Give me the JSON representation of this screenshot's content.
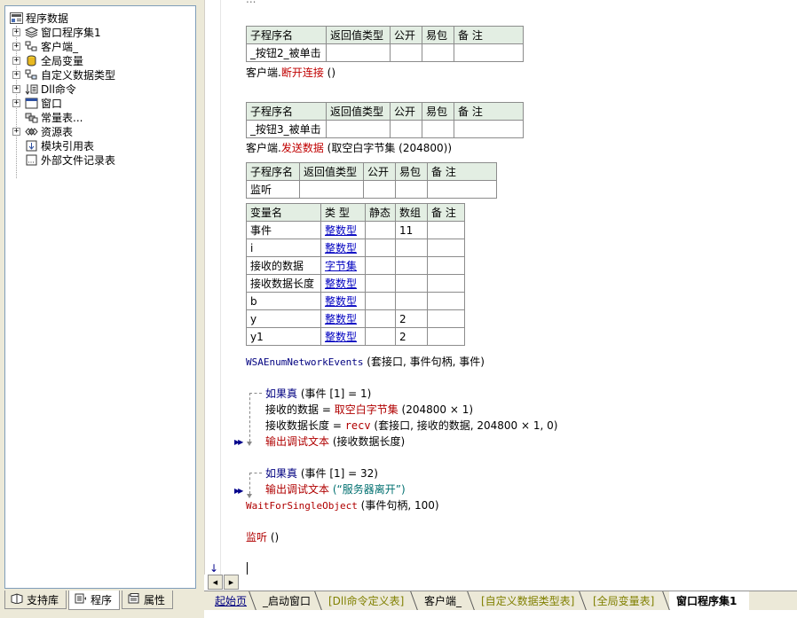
{
  "tree": {
    "root": {
      "icon": "program-data-icon",
      "label": "程序数据"
    },
    "items": [
      {
        "label": "窗口程序集1",
        "icon": "layers-icon",
        "expandable": true
      },
      {
        "label": "客户端_",
        "icon": "class-module-icon",
        "expandable": true
      },
      {
        "label": "全局变量",
        "icon": "database-icon",
        "expandable": true
      },
      {
        "label": "自定义数据类型",
        "icon": "data-type-icon",
        "expandable": true
      },
      {
        "label": "Dll命令",
        "icon": "dll-command-icon",
        "expandable": true
      },
      {
        "label": "窗口",
        "icon": "window-icon",
        "expandable": true
      },
      {
        "label": "常量表...",
        "icon": "constants-icon",
        "expandable": false
      },
      {
        "label": "资源表",
        "icon": "resources-icon",
        "expandable": true
      },
      {
        "label": "模块引用表",
        "icon": "module-ref-icon",
        "expandable": false
      },
      {
        "label": "外部文件记录表",
        "icon": "external-file-icon",
        "expandable": false
      }
    ]
  },
  "panel_tabs": [
    {
      "label": "支持库",
      "icon": "book-icon"
    },
    {
      "label": "程序",
      "icon": "program-icon",
      "active": true
    },
    {
      "label": "属性",
      "icon": "properties-icon"
    }
  ],
  "proc_header": {
    "name": "子程序名",
    "ret": "返回值类型",
    "public": "公开",
    "easy": "易包",
    "note": "备 注"
  },
  "var_header": {
    "name": "变量名",
    "type": "类 型",
    "static": "静态",
    "array": "数组",
    "note": "备 注"
  },
  "top_partial": "...",
  "procs": [
    {
      "name": "_按钮2_被单击",
      "code_obj": "客户端.",
      "code_method": "断开连接",
      "code_args": " ()"
    },
    {
      "name": "_按钮3_被单击",
      "code_obj": "客户端.",
      "code_method": "发送数据",
      "code_args": " (取空白字节集 (204800))"
    },
    {
      "name": "监听"
    }
  ],
  "variables": [
    {
      "name": "事件",
      "type": "整数型",
      "static": "",
      "array": "11",
      "note": ""
    },
    {
      "name": "i",
      "type": "整数型",
      "static": "",
      "array": "",
      "note": ""
    },
    {
      "name": "接收的数据",
      "type": "字节集",
      "static": "",
      "array": "",
      "note": ""
    },
    {
      "name": "接收数据长度",
      "type": "整数型",
      "static": "",
      "array": "",
      "note": ""
    },
    {
      "name": "b",
      "type": "整数型",
      "static": "",
      "array": "",
      "note": ""
    },
    {
      "name": "y",
      "type": "整数型",
      "static": "",
      "array": "2",
      "note": ""
    },
    {
      "name": "y1",
      "type": "整数型",
      "static": "",
      "array": "2",
      "note": ""
    }
  ],
  "code": {
    "l1_fn": "WSAEnumNetworkEvents",
    "l1_args": " (套接口, 事件句柄, 事件)",
    "if1": "如果真",
    "if1_cond": " (事件 [1] = 1)",
    "l2_a": "接收的数据 = ",
    "l2_fn": "取空白字节集",
    "l2_b": " (204800 × 1)",
    "l3_a": "接收数据长度 = ",
    "l3_fn": "recv",
    "l3_b": " (套接口, 接收的数据, 204800 × 1, 0)",
    "l4_fn": "输出调试文本",
    "l4_args": " (接收数据长度)",
    "if2": "如果真",
    "if2_cond": " (事件 [1] = 32)",
    "l5_fn": "输出调试文本",
    "l5_args": " (“服务器离开”)",
    "l6_fn": "WaitForSingleObject",
    "l6_args": " (事件句柄, 100)",
    "l7_fn": "监听",
    "l7_args": " ()"
  },
  "doc_tabs": [
    {
      "label": "起始页",
      "active": false,
      "color": "#000080"
    },
    {
      "label": "_启动窗口",
      "active": false,
      "color": "#000000"
    },
    {
      "label": "[Dll命令定义表]",
      "active": false,
      "color": "#808000"
    },
    {
      "label": "客户端_",
      "active": false,
      "color": "#000000"
    },
    {
      "label": "[自定义数据类型表]",
      "active": false,
      "color": "#808000"
    },
    {
      "label": "[全局变量表]",
      "active": false,
      "color": "#808000"
    },
    {
      "label": "窗口程序集1",
      "active": true,
      "color": "#000000"
    }
  ]
}
